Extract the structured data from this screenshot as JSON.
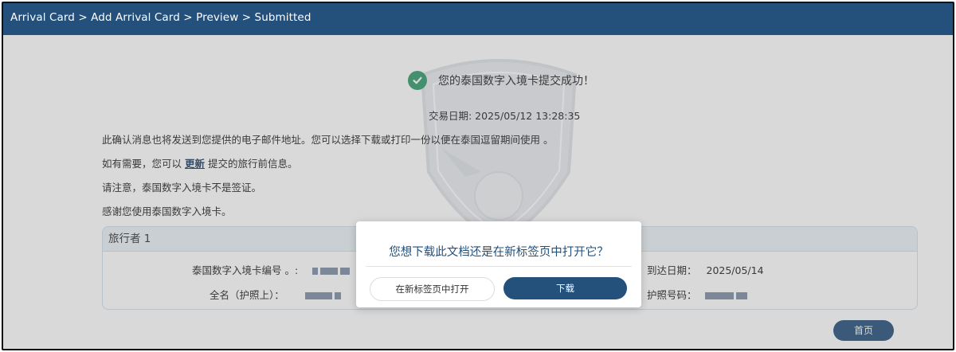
{
  "breadcrumb": "Arrival Card > Add Arrival Card > Preview > Submitted",
  "colors": {
    "topbar": "#24507c",
    "success": "#2f9a6b",
    "accent": "#24507c"
  },
  "success": {
    "icon": "check-circle-icon",
    "message": "您的泰国数字入境卡提交成功！"
  },
  "transaction_date": "交易日期: 2025/05/12 13:28:35",
  "paragraphs": {
    "p1": "此确认消息也将发送到您提供的电子邮件地址。您可以选择下载或打印一份以便在泰国逗留期间使用 。",
    "p2_before": "如有需要，您可以 ",
    "p2_link": "更新",
    "p2_after": " 提交的旅行前信息。",
    "p3": "请注意，泰国数字入境卡不是签证。",
    "p4": "感谢您使用泰国数字入境卡。"
  },
  "traveller": {
    "title": "旅行者 1",
    "card_no_label": "泰国数字入境卡编号 。:",
    "fullname_label": "全名（护照上）：",
    "arrival_label": "到达日期：",
    "arrival_value": "2025/05/14",
    "passport_label": "护照号码："
  },
  "home_button": "首页",
  "modal": {
    "title": "您想下载此文档还是在新标签页中打开它？",
    "open_button": "在新标签页中打开",
    "download_button": "下载"
  }
}
